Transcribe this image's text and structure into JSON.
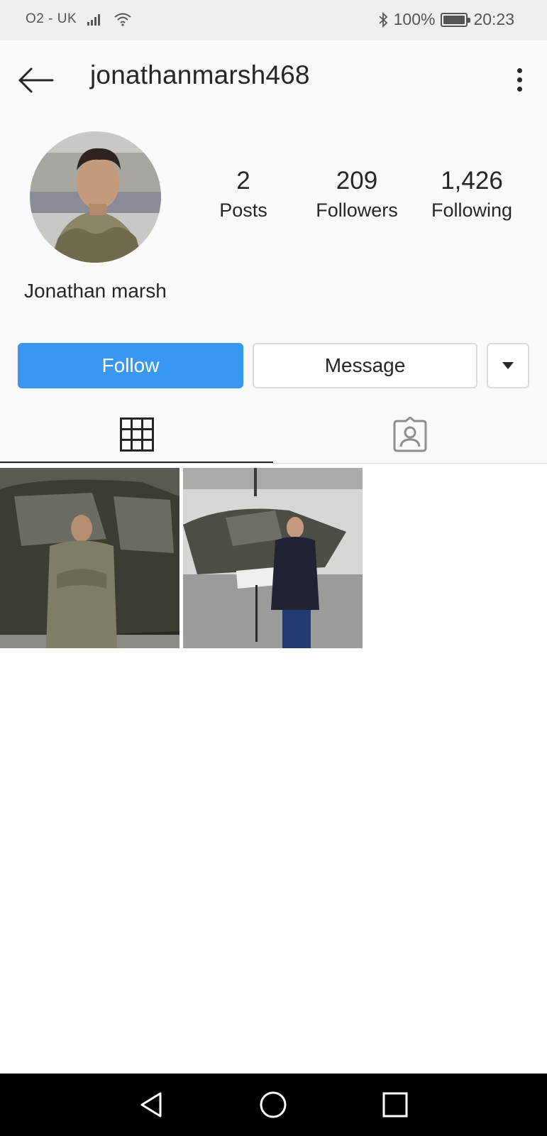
{
  "status_bar": {
    "carrier": "O2 - UK",
    "battery_percent": "100%",
    "time": "20:23",
    "icons": [
      "signal-icon",
      "wifi-icon",
      "bluetooth-icon",
      "battery-icon"
    ]
  },
  "header": {
    "username": "jonathanmarsh468",
    "back_icon": "back-arrow-icon",
    "more_icon": "more-vertical-icon"
  },
  "profile": {
    "display_name": "Jonathan marsh",
    "stats": [
      {
        "value": "2",
        "label": "Posts"
      },
      {
        "value": "209",
        "label": "Followers"
      },
      {
        "value": "1,426",
        "label": "Following"
      }
    ]
  },
  "actions": {
    "follow_label": "Follow",
    "message_label": "Message",
    "dropdown_icon": "caret-down-icon"
  },
  "tabs": [
    {
      "icon": "grid-icon",
      "active": true
    },
    {
      "icon": "tagged-user-icon",
      "active": false
    }
  ],
  "colors": {
    "accent": "#3897f0",
    "text": "#262626",
    "border": "#dbdbdb",
    "background": "#fafafa"
  },
  "posts": [
    {
      "icon": "photo-soldier-helicopter"
    },
    {
      "icon": "photo-officer-aircraft"
    }
  ],
  "nav": [
    "back-triangle-icon",
    "home-circle-icon",
    "recents-square-icon"
  ]
}
